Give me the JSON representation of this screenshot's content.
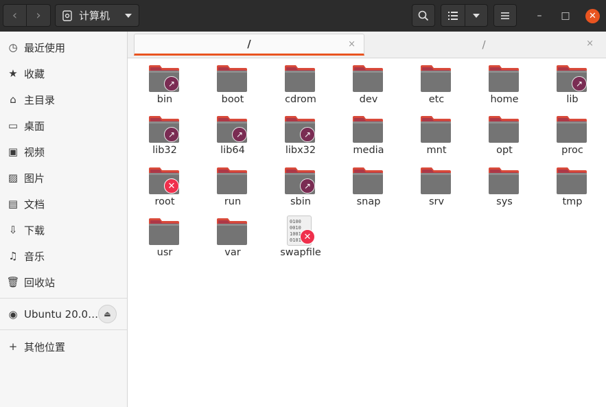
{
  "header": {
    "path_label": "计算机",
    "back_glyph": "‹",
    "forward_glyph": "›",
    "search_glyph": "⌕",
    "view_glyph": "☰",
    "menu_glyph": "≡",
    "minimize_glyph": "–",
    "maximize_glyph": "□",
    "close_glyph": "✕"
  },
  "sidebar": {
    "items": [
      {
        "label": "最近使用",
        "icon": "clock-icon",
        "glyph": "◷"
      },
      {
        "label": "收藏",
        "icon": "star-icon",
        "glyph": "★"
      },
      {
        "label": "主目录",
        "icon": "home-icon",
        "glyph": "⌂"
      },
      {
        "label": "桌面",
        "icon": "desktop-icon",
        "glyph": "▭"
      },
      {
        "label": "视频",
        "icon": "video-icon",
        "glyph": "▣"
      },
      {
        "label": "图片",
        "icon": "picture-icon",
        "glyph": "▨"
      },
      {
        "label": "文档",
        "icon": "document-icon",
        "glyph": "▤"
      },
      {
        "label": "下载",
        "icon": "download-icon",
        "glyph": "⇩"
      },
      {
        "label": "音乐",
        "icon": "music-icon",
        "glyph": "♫"
      },
      {
        "label": "回收站",
        "icon": "trash-icon",
        "glyph": "🗑"
      }
    ],
    "device": {
      "label": "Ubuntu 20.0…",
      "icon": "disc-icon",
      "glyph": "◉",
      "eject_glyph": "⏏"
    },
    "other": {
      "label": "其他位置",
      "glyph": "+"
    }
  },
  "tabs": [
    {
      "label": "/",
      "close_glyph": "×"
    },
    {
      "label": "/",
      "close_glyph": "×"
    }
  ],
  "colors": {
    "accent": "#e95420",
    "folder_top": "#d84a3a",
    "folder_body": "#747474",
    "link_emblem": "#7a2c53",
    "noaccess_emblem": "#ef2f4c"
  },
  "files": [
    {
      "name": "bin",
      "type": "folder",
      "emblem": "link"
    },
    {
      "name": "boot",
      "type": "folder",
      "emblem": ""
    },
    {
      "name": "cdrom",
      "type": "folder",
      "emblem": ""
    },
    {
      "name": "dev",
      "type": "folder",
      "emblem": ""
    },
    {
      "name": "etc",
      "type": "folder",
      "emblem": ""
    },
    {
      "name": "home",
      "type": "folder",
      "emblem": ""
    },
    {
      "name": "lib",
      "type": "folder",
      "emblem": "link"
    },
    {
      "name": "lib32",
      "type": "folder",
      "emblem": "link"
    },
    {
      "name": "lib64",
      "type": "folder",
      "emblem": "link"
    },
    {
      "name": "libx32",
      "type": "folder",
      "emblem": "link"
    },
    {
      "name": "media",
      "type": "folder",
      "emblem": ""
    },
    {
      "name": "mnt",
      "type": "folder",
      "emblem": ""
    },
    {
      "name": "opt",
      "type": "folder",
      "emblem": ""
    },
    {
      "name": "proc",
      "type": "folder",
      "emblem": ""
    },
    {
      "name": "root",
      "type": "folder",
      "emblem": "noaccess"
    },
    {
      "name": "run",
      "type": "folder",
      "emblem": ""
    },
    {
      "name": "sbin",
      "type": "folder",
      "emblem": "link"
    },
    {
      "name": "snap",
      "type": "folder",
      "emblem": ""
    },
    {
      "name": "srv",
      "type": "folder",
      "emblem": ""
    },
    {
      "name": "sys",
      "type": "folder",
      "emblem": ""
    },
    {
      "name": "tmp",
      "type": "folder",
      "emblem": ""
    },
    {
      "name": "usr",
      "type": "folder",
      "emblem": ""
    },
    {
      "name": "var",
      "type": "folder",
      "emblem": ""
    },
    {
      "name": "swapfile",
      "type": "binary",
      "emblem": "noaccess",
      "preview_text": "0100\n0010\n1001\n0101"
    }
  ]
}
